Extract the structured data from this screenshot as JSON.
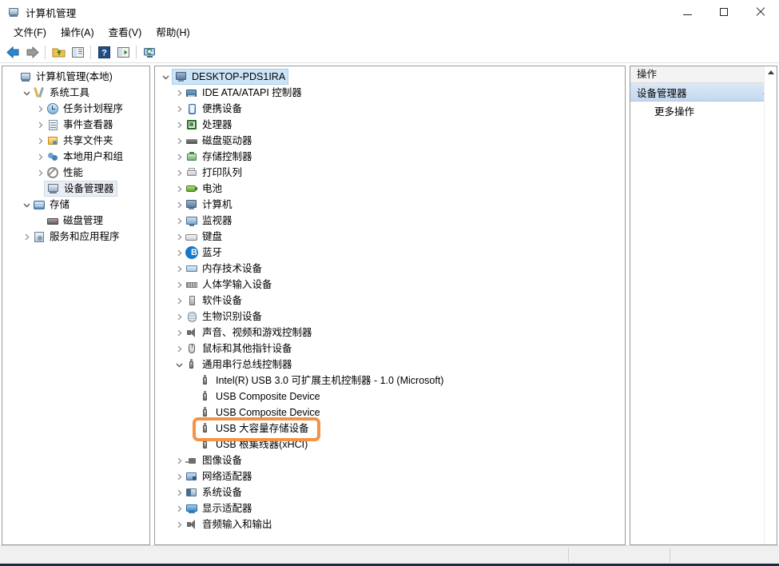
{
  "window": {
    "title": "计算机管理",
    "icon": "computer-management-icon",
    "controls": {
      "minimize": "最小化",
      "maximize": "最大化",
      "close": "关闭"
    }
  },
  "menubar": {
    "items": [
      {
        "label": "文件(F)",
        "name": "menu-file"
      },
      {
        "label": "操作(A)",
        "name": "menu-action"
      },
      {
        "label": "查看(V)",
        "name": "menu-view"
      },
      {
        "label": "帮助(H)",
        "name": "menu-help"
      }
    ]
  },
  "toolbar": {
    "buttons": [
      {
        "name": "back-button",
        "icon": "arrow-left-icon"
      },
      {
        "name": "forward-button",
        "icon": "arrow-right-icon"
      },
      {
        "name": "up-one-level-button",
        "icon": "folder-up-icon"
      },
      {
        "name": "show-hide-tree-button",
        "icon": "panel-icon"
      },
      {
        "name": "help-button",
        "icon": "question-mark-icon"
      },
      {
        "name": "properties-button",
        "icon": "panel-play-icon"
      },
      {
        "name": "scan-hardware-changes-button",
        "icon": "monitor-refresh-icon"
      }
    ]
  },
  "sidebar": {
    "items": [
      {
        "label": "计算机管理(本地)",
        "indent": 0,
        "twisty": "none",
        "icon": "computer-management-icon",
        "name": "sidebar-item-computer-management",
        "selected": false
      },
      {
        "label": "系统工具",
        "indent": 1,
        "twisty": "expanded",
        "icon": "tools-icon",
        "name": "sidebar-item-system-tools",
        "selected": false
      },
      {
        "label": "任务计划程序",
        "indent": 2,
        "twisty": "collapsed",
        "icon": "clock-icon",
        "name": "sidebar-item-task-scheduler",
        "selected": false
      },
      {
        "label": "事件查看器",
        "indent": 2,
        "twisty": "collapsed",
        "icon": "event-viewer-icon",
        "name": "sidebar-item-event-viewer",
        "selected": false
      },
      {
        "label": "共享文件夹",
        "indent": 2,
        "twisty": "collapsed",
        "icon": "shared-folder-icon",
        "name": "sidebar-item-shared-folders",
        "selected": false
      },
      {
        "label": "本地用户和组",
        "indent": 2,
        "twisty": "collapsed",
        "icon": "users-icon",
        "name": "sidebar-item-local-users-groups",
        "selected": false
      },
      {
        "label": "性能",
        "indent": 2,
        "twisty": "collapsed",
        "icon": "performance-icon",
        "name": "sidebar-item-performance",
        "selected": false
      },
      {
        "label": "设备管理器",
        "indent": 2,
        "twisty": "none",
        "icon": "device-manager-icon",
        "name": "sidebar-item-device-manager",
        "selected": true
      },
      {
        "label": "存储",
        "indent": 1,
        "twisty": "expanded",
        "icon": "storage-icon",
        "name": "sidebar-item-storage",
        "selected": false
      },
      {
        "label": "磁盘管理",
        "indent": 2,
        "twisty": "none",
        "icon": "disk-management-icon",
        "name": "sidebar-item-disk-management",
        "selected": false
      },
      {
        "label": "服务和应用程序",
        "indent": 1,
        "twisty": "collapsed",
        "icon": "services-icon",
        "name": "sidebar-item-services-apps",
        "selected": false
      }
    ]
  },
  "device_tree": {
    "root": {
      "label": "DESKTOP-PDS1IRA",
      "icon": "computer-icon",
      "twisty": "expanded",
      "selected": true
    },
    "items": [
      {
        "label": "IDE ATA/ATAPI 控制器",
        "indent": 1,
        "twisty": "collapsed",
        "icon": "ide-controller-icon",
        "name": "device-node-ide-controllers"
      },
      {
        "label": "便携设备",
        "indent": 1,
        "twisty": "collapsed",
        "icon": "portable-device-icon",
        "name": "device-node-portable-devices"
      },
      {
        "label": "处理器",
        "indent": 1,
        "twisty": "collapsed",
        "icon": "processor-icon",
        "name": "device-node-processors"
      },
      {
        "label": "磁盘驱动器",
        "indent": 1,
        "twisty": "collapsed",
        "icon": "disk-drive-icon",
        "name": "device-node-disk-drives"
      },
      {
        "label": "存储控制器",
        "indent": 1,
        "twisty": "collapsed",
        "icon": "storage-controller-icon",
        "name": "device-node-storage-controllers"
      },
      {
        "label": "打印队列",
        "indent": 1,
        "twisty": "collapsed",
        "icon": "print-queue-icon",
        "name": "device-node-print-queues"
      },
      {
        "label": "电池",
        "indent": 1,
        "twisty": "collapsed",
        "icon": "battery-icon",
        "name": "device-node-batteries"
      },
      {
        "label": "计算机",
        "indent": 1,
        "twisty": "collapsed",
        "icon": "computer-icon",
        "name": "device-node-computer"
      },
      {
        "label": "监视器",
        "indent": 1,
        "twisty": "collapsed",
        "icon": "monitor-icon",
        "name": "device-node-monitors"
      },
      {
        "label": "键盘",
        "indent": 1,
        "twisty": "collapsed",
        "icon": "keyboard-icon",
        "name": "device-node-keyboards"
      },
      {
        "label": "蓝牙",
        "indent": 1,
        "twisty": "collapsed",
        "icon": "bluetooth-icon",
        "name": "device-node-bluetooth"
      },
      {
        "label": "内存技术设备",
        "indent": 1,
        "twisty": "collapsed",
        "icon": "memory-device-icon",
        "name": "device-node-memory-technology"
      },
      {
        "label": "人体学输入设备",
        "indent": 1,
        "twisty": "collapsed",
        "icon": "hid-icon",
        "name": "device-node-hid"
      },
      {
        "label": "软件设备",
        "indent": 1,
        "twisty": "collapsed",
        "icon": "software-device-icon",
        "name": "device-node-software-devices"
      },
      {
        "label": "生物识别设备",
        "indent": 1,
        "twisty": "collapsed",
        "icon": "biometric-icon",
        "name": "device-node-biometric"
      },
      {
        "label": "声音、视频和游戏控制器",
        "indent": 1,
        "twisty": "collapsed",
        "icon": "speaker-icon",
        "name": "device-node-sound-video-game"
      },
      {
        "label": "鼠标和其他指针设备",
        "indent": 1,
        "twisty": "collapsed",
        "icon": "mouse-icon",
        "name": "device-node-mice"
      },
      {
        "label": "通用串行总线控制器",
        "indent": 1,
        "twisty": "expanded",
        "icon": "usb-icon",
        "name": "device-node-usb-controllers"
      },
      {
        "label": "Intel(R) USB 3.0 可扩展主机控制器 - 1.0 (Microsoft)",
        "indent": 2,
        "twisty": "none",
        "icon": "usb-icon",
        "name": "device-leaf-intel-usb3-xhci"
      },
      {
        "label": "USB Composite Device",
        "indent": 2,
        "twisty": "none",
        "icon": "usb-icon",
        "name": "device-leaf-usb-composite-1"
      },
      {
        "label": "USB Composite Device",
        "indent": 2,
        "twisty": "none",
        "icon": "usb-icon",
        "name": "device-leaf-usb-composite-2"
      },
      {
        "label": "USB 大容量存储设备",
        "indent": 2,
        "twisty": "none",
        "icon": "usb-icon",
        "name": "device-leaf-usb-mass-storage",
        "highlighted": true
      },
      {
        "label": "USB 根集线器(xHCI)",
        "indent": 2,
        "twisty": "none",
        "icon": "usb-icon",
        "name": "device-leaf-usb-root-hub-xhci"
      },
      {
        "label": "图像设备",
        "indent": 1,
        "twisty": "collapsed",
        "icon": "imaging-device-icon",
        "name": "device-node-imaging-devices"
      },
      {
        "label": "网络适配器",
        "indent": 1,
        "twisty": "collapsed",
        "icon": "network-adapter-icon",
        "name": "device-node-network-adapters"
      },
      {
        "label": "系统设备",
        "indent": 1,
        "twisty": "collapsed",
        "icon": "system-device-icon",
        "name": "device-node-system-devices"
      },
      {
        "label": "显示适配器",
        "indent": 1,
        "twisty": "collapsed",
        "icon": "display-adapter-icon",
        "name": "device-node-display-adapters"
      },
      {
        "label": "音频输入和输出",
        "indent": 1,
        "twisty": "collapsed",
        "icon": "audio-io-icon",
        "name": "device-node-audio-inputs-outputs"
      }
    ]
  },
  "actions_pane": {
    "header": "操作",
    "group_title": "设备管理器",
    "group_collapse_icon": "caret-up-icon",
    "items": [
      {
        "label": "更多操作",
        "submenu_icon": "caret-right-icon",
        "name": "action-more-actions"
      }
    ]
  },
  "highlight": {
    "color": "#f59245",
    "target": "USB 大容量存储设备"
  },
  "statusbar": {
    "cells": [
      "",
      "",
      "",
      ""
    ]
  }
}
